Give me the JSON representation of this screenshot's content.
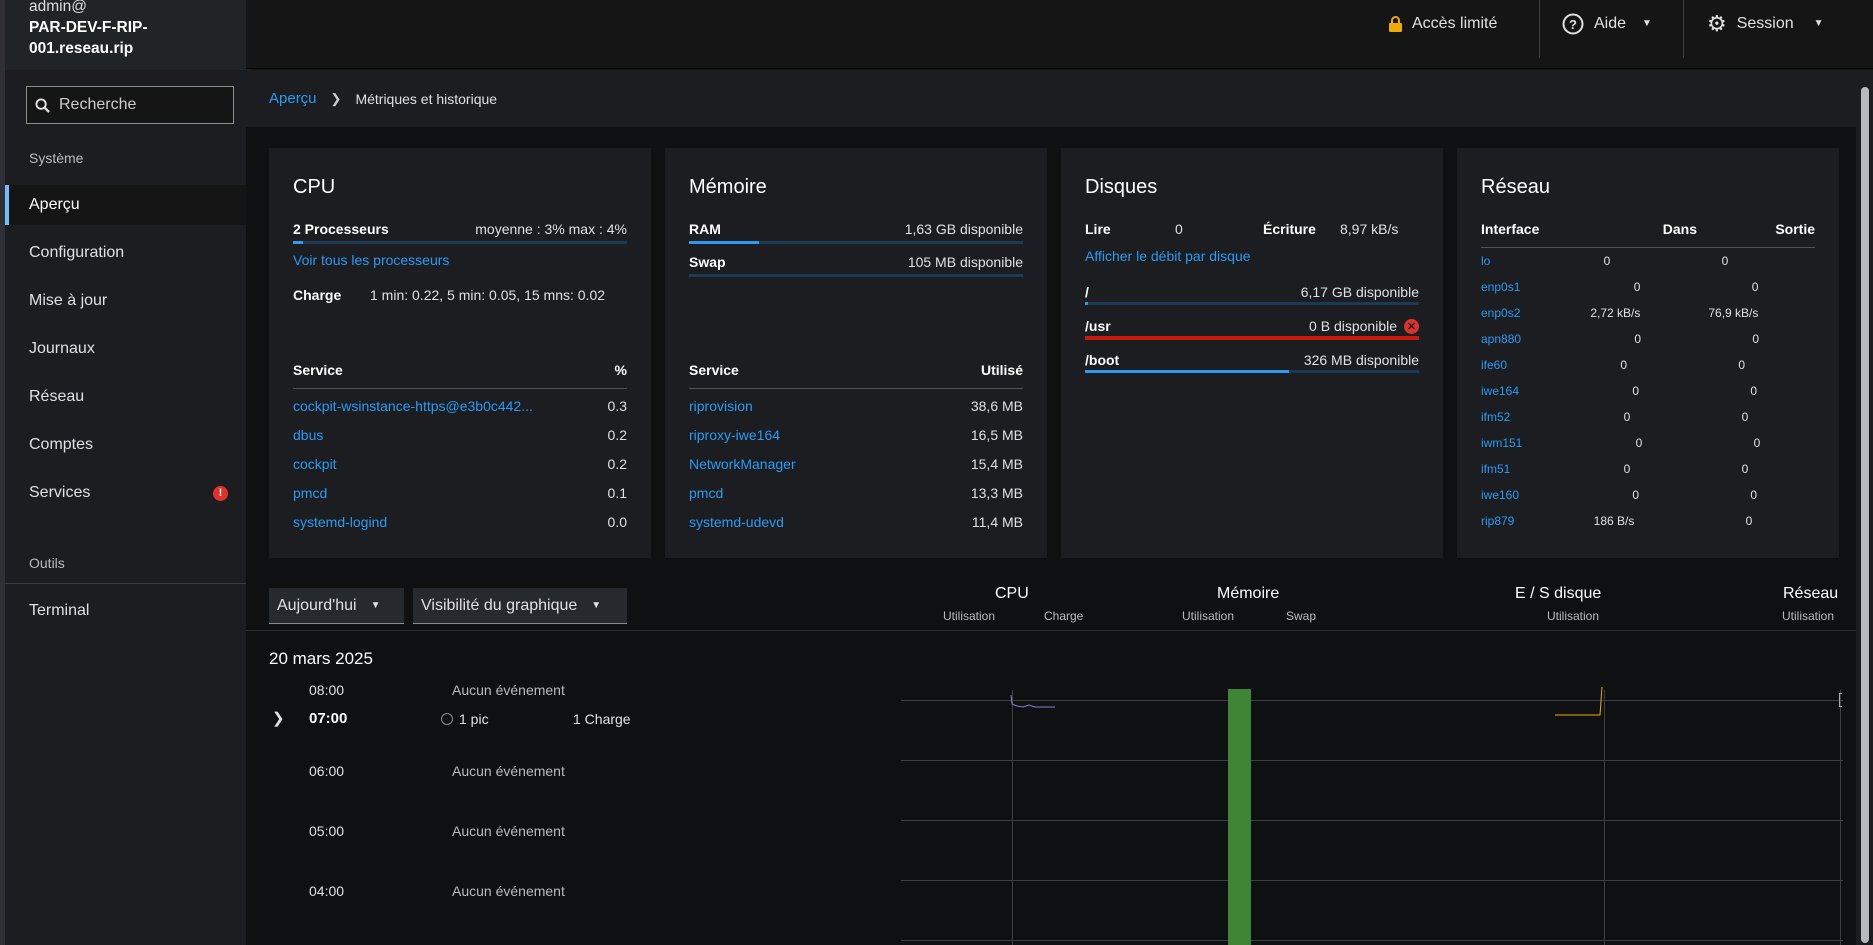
{
  "host": {
    "user": "admin@",
    "name_line1": "PAR-DEV-F-RIP-",
    "name_line2": "001.reseau.rip"
  },
  "search": {
    "placeholder": "Recherche"
  },
  "nav": {
    "section_system": "Système",
    "items": [
      "Aperçu",
      "Configuration",
      "Mise à jour",
      "Journaux",
      "Réseau",
      "Comptes",
      "Services"
    ],
    "services_badge": "!",
    "section_tools": "Outils",
    "terminal": "Terminal"
  },
  "topbar": {
    "limited_access": "Accès limité",
    "help": "Aide",
    "session": "Session"
  },
  "breadcrumb": {
    "root": "Aperçu",
    "current": "Métriques et historique"
  },
  "cpu": {
    "title": "CPU",
    "processors": "2 Processeurs",
    "avg_max": "moyenne : 3% max : 4%",
    "usage_fraction": 0.03,
    "see_all": "Voir tous les processeurs",
    "load_label": "Charge",
    "load_value": "1 min: 0.22, 5 min: 0.05, 15 mns: 0.02",
    "col_service": "Service",
    "col_pct": "%",
    "rows": [
      {
        "name": "cockpit-wsinstance-https@e3b0c442...",
        "value": "0.3"
      },
      {
        "name": "dbus",
        "value": "0.2"
      },
      {
        "name": "cockpit",
        "value": "0.2"
      },
      {
        "name": "pmcd",
        "value": "0.1"
      },
      {
        "name": "systemd-logind",
        "value": "0.0"
      }
    ]
  },
  "memory": {
    "title": "Mémoire",
    "ram_label": "RAM",
    "ram_value": "1,63 GB disponible",
    "ram_fraction": 0.21,
    "swap_label": "Swap",
    "swap_value": "105 MB disponible",
    "swap_fraction": 0.0,
    "col_service": "Service",
    "col_used": "Utilisé",
    "rows": [
      {
        "name": "riprovision",
        "value": "38,6 MB"
      },
      {
        "name": "riproxy-iwe164",
        "value": "16,5 MB"
      },
      {
        "name": "NetworkManager",
        "value": "15,4 MB"
      },
      {
        "name": "pmcd",
        "value": "13,3 MB"
      },
      {
        "name": "systemd-udevd",
        "value": "11,4 MB"
      }
    ]
  },
  "disks": {
    "title": "Disques",
    "read_label": "Lire",
    "read_value": "0",
    "write_label": "Écriture",
    "write_value": "8,97 kB/s",
    "per_disk_link": "Afficher le débit par disque",
    "mounts": [
      {
        "path": "/",
        "value": "6,17 GB disponible",
        "fraction": 0.01,
        "color": "#2b9af3"
      },
      {
        "path": "/usr",
        "value": "0 B disponible",
        "fraction": 1.0,
        "color": "#c9190b",
        "error": true
      },
      {
        "path": "/boot",
        "value": "326 MB disponible",
        "fraction": 0.61,
        "color": "#2b9af3"
      }
    ]
  },
  "network": {
    "title": "Réseau",
    "col_iface": "Interface",
    "col_in": "Dans",
    "col_out": "Sortie",
    "rows": [
      {
        "name": "lo",
        "in": "0",
        "out": "0"
      },
      {
        "name": "enp0s1",
        "in": "0",
        "out": "0"
      },
      {
        "name": "enp0s2",
        "in": "2,72 kB/s",
        "out": "76,9 kB/s"
      },
      {
        "name": "apn880",
        "in": "0",
        "out": "0"
      },
      {
        "name": "ife60",
        "in": "0",
        "out": "0"
      },
      {
        "name": "iwe164",
        "in": "0",
        "out": "0"
      },
      {
        "name": "ifm52",
        "in": "0",
        "out": "0"
      },
      {
        "name": "iwm151",
        "in": "0",
        "out": "0"
      },
      {
        "name": "ifm51",
        "in": "0",
        "out": "0"
      },
      {
        "name": "iwe160",
        "in": "0",
        "out": "0"
      },
      {
        "name": "rip879",
        "in": "186 B/s",
        "out": "0"
      }
    ]
  },
  "history": {
    "range_select": "Aujourd'hui",
    "visibility_select": "Visibilité du graphique",
    "col_cpu": "CPU",
    "col_memory": "Mémoire",
    "col_disk": "E / S disque",
    "col_network": "Réseau",
    "sub_usage": "Utilisation",
    "sub_load": "Charge",
    "sub_swap": "Swap",
    "date": "20 mars 2025",
    "hours": [
      {
        "time": "08:00",
        "event": "Aucun événement"
      },
      {
        "time": "07:00",
        "event": "1 pic",
        "extra": "1 Charge"
      },
      {
        "time": "06:00",
        "event": "Aucun événement"
      },
      {
        "time": "05:00",
        "event": "Aucun événement"
      },
      {
        "time": "04:00",
        "event": "Aucun événement"
      }
    ]
  },
  "colors": {
    "accent": "#2b9af3",
    "memory_bar": "#3e8635",
    "cpu_line": "#8481dd",
    "disk_line": "#f0ab00"
  }
}
